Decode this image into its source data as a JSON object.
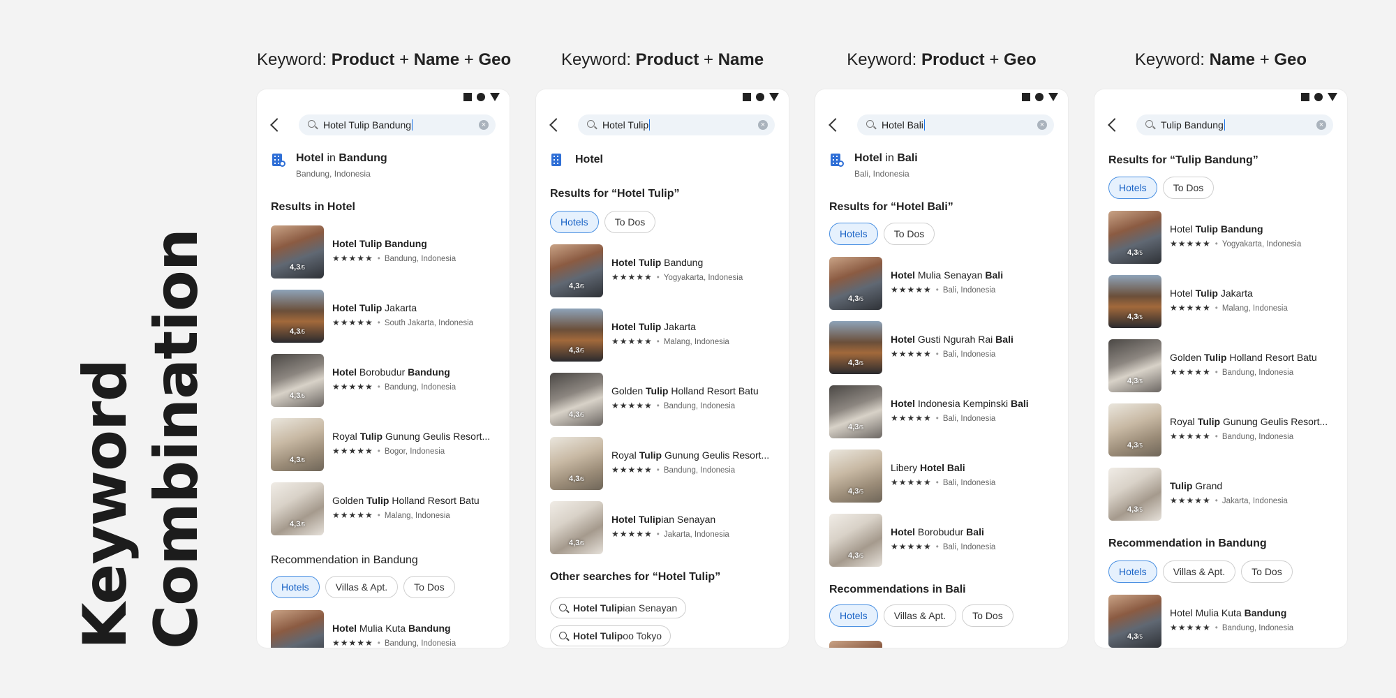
{
  "side_title": {
    "line1": "Keyword",
    "line2": "Combination"
  },
  "columns": [
    {
      "head_prefix": "Keyword:",
      "head_bold1": "Product",
      "head_plus1": "+",
      "head_bold2": "Name",
      "head_plus2": "+",
      "head_bold3": "Geo",
      "search_value": "Hotel Tulip Bandung",
      "dest_bold": "Hotel",
      "dest_mid": " in ",
      "dest_bold2": "Bandung",
      "dest_sub": "Bandung, Indonesia",
      "section1": "Results in Hotel",
      "items": [
        {
          "a": "Hotel Tulip Bandung",
          "b": "",
          "c": "",
          "loc": "Bandung, Indonesia"
        },
        {
          "a": "Hotel Tulip",
          "b": " Jakarta",
          "c": "",
          "loc": "South Jakarta, Indonesia"
        },
        {
          "a": "Hotel",
          "b": " Borobudur ",
          "c": "Bandung",
          "loc": "Bandung, Indonesia"
        },
        {
          "a": "",
          "b": "Royal ",
          "c": "Tulip",
          "d": " Gunung Geulis Resort...",
          "loc": "Bogor, Indonesia"
        },
        {
          "a": "",
          "b": "Golden ",
          "c": "Tulip",
          "d": " Holland Resort Batu",
          "loc": "Malang, Indonesia"
        }
      ],
      "section2": "Recommendation in Bandung",
      "chips2": [
        "Hotels",
        "Villas & Apt.",
        "To Dos"
      ],
      "rec": {
        "a": "Hotel",
        "b": " Mulia Kuta ",
        "c": "Bandung",
        "loc": "Bandung, Indonesia"
      }
    },
    {
      "head_prefix": "Keyword:",
      "head_bold1": "Product",
      "head_plus1": "+",
      "head_bold2": "Name",
      "search_value": "Hotel Tulip",
      "dest_bold": "Hotel",
      "section1": "Results for “Hotel Tulip”",
      "chips1": [
        "Hotels",
        "To Dos"
      ],
      "items": [
        {
          "a": "Hotel Tulip",
          "b": " Bandung",
          "loc": "Yogyakarta, Indonesia"
        },
        {
          "a": "Hotel Tulip",
          "b": " Jakarta",
          "loc": "Malang, Indonesia"
        },
        {
          "b": "Golden ",
          "c": "Tulip",
          "d": " Holland Resort Batu",
          "loc": "Bandung, Indonesia"
        },
        {
          "b": "Royal ",
          "c": "Tulip",
          "d": " Gunung Geulis Resort...",
          "loc": "Bandung, Indonesia"
        },
        {
          "a": "Hotel Tulip",
          "b": "ian Senayan",
          "loc": "Jakarta, Indonesia"
        }
      ],
      "section2": "Other searches for “Hotel Tulip”",
      "others": [
        {
          "bold": "Hotel Tulip",
          "rest": "ian Senayan"
        },
        {
          "bold": "Hotel Tulip",
          "rest": "oo Tokyo"
        }
      ]
    },
    {
      "head_prefix": "Keyword:",
      "head_bold1": "Product",
      "head_plus1": "+",
      "head_bold2": "Geo",
      "search_value": "Hotel Bali",
      "dest_bold": "Hotel",
      "dest_mid": " in ",
      "dest_bold2": "Bali",
      "dest_sub": "Bali, Indonesia",
      "section1": "Results for “Hotel Bali”",
      "chips1": [
        "Hotels",
        "To Dos"
      ],
      "items": [
        {
          "a": "Hotel",
          "b": " Mulia Senayan ",
          "c": "Bali",
          "loc": "Bali, Indonesia"
        },
        {
          "a": "Hotel",
          "b": " Gusti Ngurah Rai ",
          "c": "Bali",
          "loc": "Bali, Indonesia"
        },
        {
          "a": "Hotel",
          "b": " Indonesia Kempinski ",
          "c": "Bali",
          "loc": "Bali, Indonesia"
        },
        {
          "b": "Libery ",
          "c": "Hotel Bali",
          "loc": "Bali, Indonesia"
        },
        {
          "a": "Hotel",
          "b": " Borobudur ",
          "c": "Bali",
          "loc": "Bali, Indonesia"
        }
      ],
      "section2": "Recommendations in Bali",
      "chips2": [
        "Hotels",
        "Villas & Apt.",
        "To Dos"
      ]
    },
    {
      "head_prefix": "Keyword:",
      "head_bold1": "Name",
      "head_plus1": "+",
      "head_bold2": "Geo",
      "search_value": "Tulip Bandung",
      "section1": "Results for “Tulip Bandung”",
      "chips1": [
        "Hotels",
        "To Dos"
      ],
      "items": [
        {
          "b": "Hotel ",
          "c": "Tulip Bandung",
          "loc": "Yogyakarta, Indonesia"
        },
        {
          "b": "Hotel ",
          "c": "Tulip",
          "d": " Jakarta",
          "loc": "Malang, Indonesia"
        },
        {
          "b": "Golden ",
          "c": "Tulip",
          "d": " Holland Resort Batu",
          "loc": "Bandung, Indonesia"
        },
        {
          "b": "Royal ",
          "c": "Tulip",
          "d": " Gunung Geulis Resort...",
          "loc": "Bandung, Indonesia"
        },
        {
          "a": "Tulip",
          "b": " Grand",
          "loc": "Jakarta, Indonesia"
        }
      ],
      "section2": "Recommendation in Bandung",
      "chips2": [
        "Hotels",
        "Villas & Apt.",
        "To Dos"
      ],
      "rec": {
        "b": "Hotel Mulia Kuta ",
        "c": "Bandung",
        "loc": "Bandung, Indonesia"
      }
    }
  ],
  "rating": "4,3",
  "rating_scale": "/5",
  "stars": "★★★★★",
  "colors": {
    "accent": "#1b64c6",
    "chip_active_bg": "#e6f1fd",
    "background": "#f3f3f3"
  },
  "icons": {
    "back": "chevron-left-icon",
    "search": "search-icon",
    "clear": "clear-icon",
    "hotel": "hotel-building-icon"
  }
}
